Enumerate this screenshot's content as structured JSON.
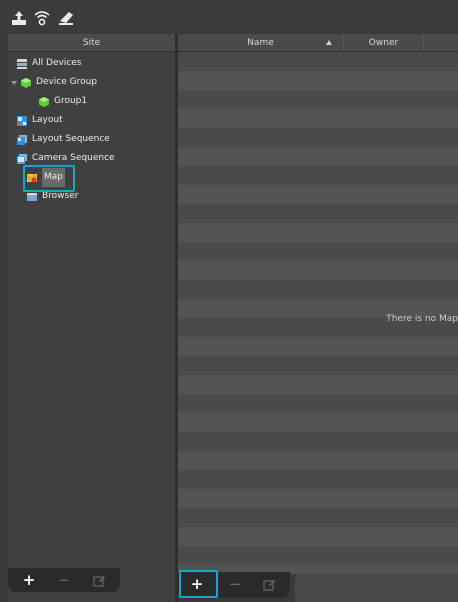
{
  "toolbar": {
    "icons": [
      "upload-icon",
      "wireless-icon",
      "eraser-icon"
    ]
  },
  "site_panel": {
    "header": "Site",
    "items": [
      {
        "label": "All Devices",
        "icon": "all-devices-icon"
      },
      {
        "label": "Device Group",
        "icon": "device-group-icon",
        "expanded": true
      },
      {
        "label": "Group1",
        "icon": "group-icon"
      },
      {
        "label": "Layout",
        "icon": "layout-icon"
      },
      {
        "label": "Layout Sequence",
        "icon": "layout-sequence-icon"
      },
      {
        "label": "Camera Sequence",
        "icon": "camera-sequence-icon"
      },
      {
        "label": "Map",
        "icon": "map-icon",
        "selected": true
      },
      {
        "label": "Browser",
        "icon": "browser-icon"
      }
    ],
    "footer": {
      "add": "+",
      "remove": "−"
    }
  },
  "list_panel": {
    "columns": {
      "name": "Name",
      "owner": "Owner"
    },
    "empty_message": "There is no Map",
    "footer": {
      "add": "+",
      "remove": "−"
    }
  },
  "colors": {
    "accent": "#15a7c4",
    "green": "#5fcf3a",
    "blue": "#3a8fd9"
  }
}
